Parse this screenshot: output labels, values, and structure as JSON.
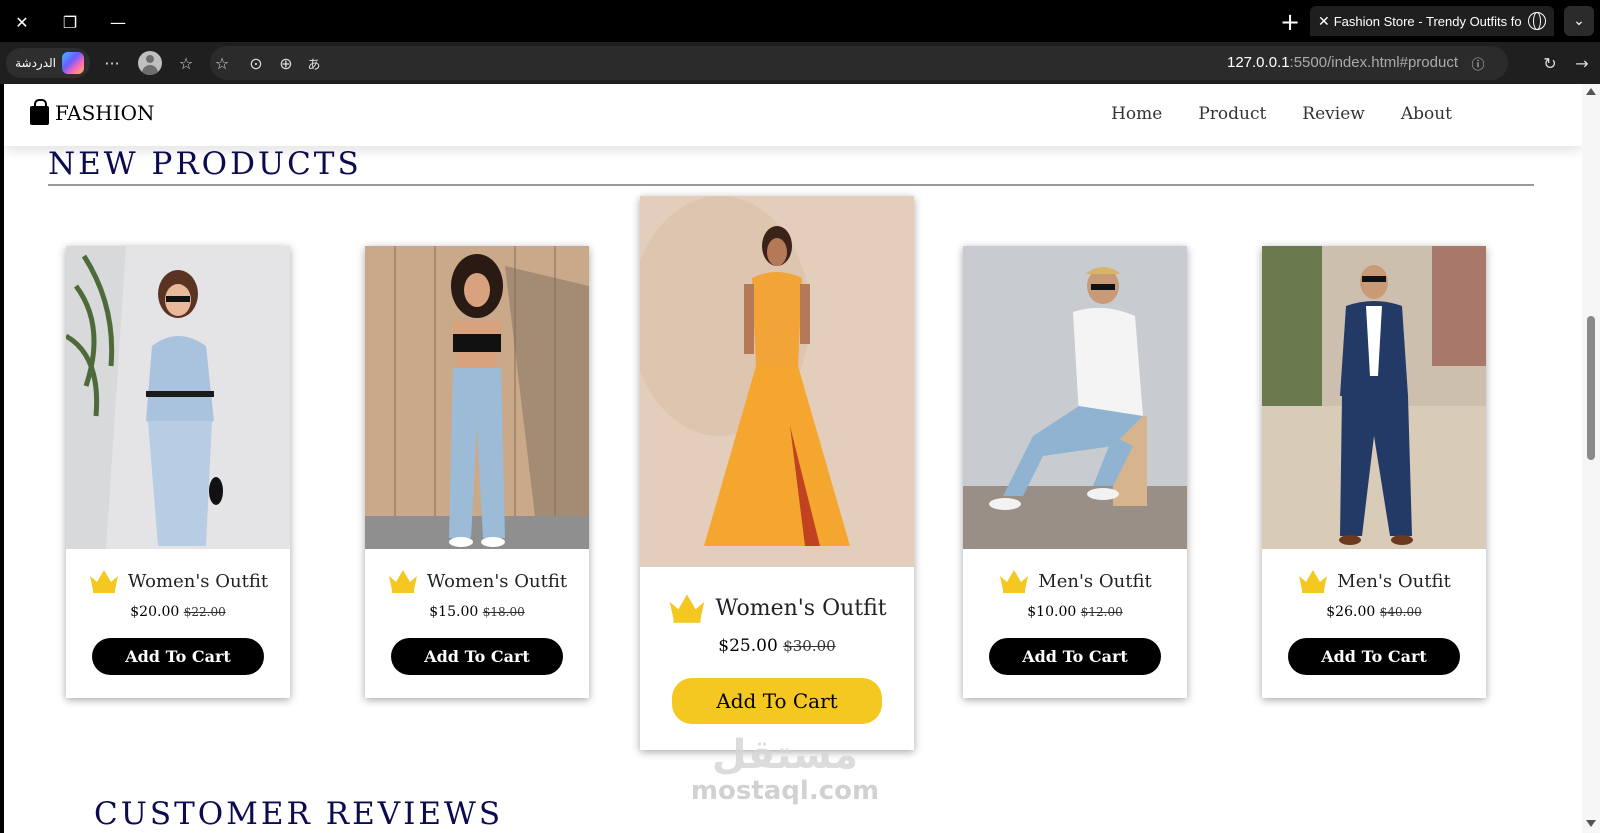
{
  "browser": {
    "tab_title": "Fashion Store - Trendy Outfits for Everyone",
    "url_host": "127.0.0.1",
    "url_rest": ":5500/index.html#product",
    "chat_label": "الدردشة",
    "more_label": "···"
  },
  "site": {
    "logo_text": "FASHION",
    "nav": [
      "Home",
      "Product",
      "Review",
      "About"
    ]
  },
  "section": {
    "title": "NEW PRODUCTS",
    "next_title": "CUSTOMER REVIEWS"
  },
  "products": [
    {
      "name": "Women's Outfit",
      "price": "$20.00",
      "old_price": "$22.00",
      "button": "Add To Cart",
      "featured": false
    },
    {
      "name": "Women's Outfit",
      "price": "$15.00",
      "old_price": "$18.00",
      "button": "Add To Cart",
      "featured": false
    },
    {
      "name": "Women's Outfit",
      "price": "$25.00",
      "old_price": "$30.00",
      "button": "Add To Cart",
      "featured": true
    },
    {
      "name": "Men's Outfit",
      "price": "$10.00",
      "old_price": "$12.00",
      "button": "Add To Cart",
      "featured": false
    },
    {
      "name": "Men's Outfit",
      "price": "$26.00",
      "old_price": "$40.00",
      "button": "Add To Cart",
      "featured": false
    }
  ],
  "watermark": {
    "arabic": "مستقل",
    "latin": "mostaql.com"
  },
  "colors": {
    "heading": "#0b0b50",
    "featured_button": "#f4c820",
    "button": "#000000",
    "crown": "#f4c820"
  }
}
